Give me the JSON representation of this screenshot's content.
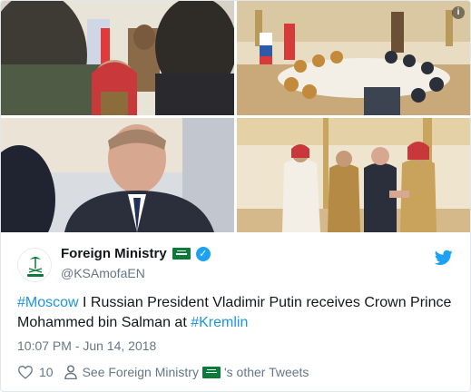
{
  "media": {
    "info_badge": "i"
  },
  "account": {
    "display_name": "Foreign Ministry",
    "handle": "@KSAmofaEN"
  },
  "tweet": {
    "hashtag1": "#Moscow",
    "text_part1": " I Russian President Vladimir Putin receives Crown Prince Mohammed bin Salman at ",
    "hashtag2": "#Kremlin",
    "timestamp": "10:07 PM - Jun 14, 2018"
  },
  "footer": {
    "like_count": "10",
    "see_prefix": "See Foreign Ministry",
    "see_suffix": "'s other Tweets"
  },
  "colors": {
    "link": "#1b95e0",
    "muted": "#657786",
    "verified": "#1da1f2",
    "flag_green": "#0b7a3b"
  },
  "icons": [
    "info-icon",
    "verified-icon",
    "saudi-flag-icon",
    "twitter-bird-icon",
    "heart-icon",
    "person-icon"
  ]
}
